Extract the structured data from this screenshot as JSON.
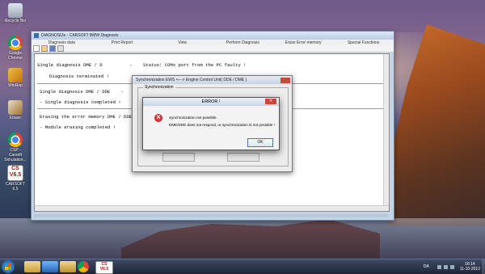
{
  "desktop": {
    "icons": [
      {
        "label": "Recycle Bin",
        "icon": "recycle-bin-icon"
      },
      {
        "label": "Google Chrome",
        "icon": "chrome-icon"
      },
      {
        "label": "WinRep",
        "icon": "tool-icon"
      },
      {
        "label": "Ebase",
        "icon": "tool-icon"
      },
      {
        "label": "CSP - Carsoft Simulation...",
        "icon": "chrome-icon"
      },
      {
        "label": "CARSOFT 6.5",
        "icon": "carsoft-icon"
      }
    ]
  },
  "app": {
    "title": "DIAGNOSIZe - CARSOFT BMW Diagnosis",
    "menu": [
      "Diagnosis data",
      "Print Report",
      "View",
      "Perform Diagnosis",
      "Erase Error memory",
      "Special Functions"
    ],
    "console_lines": [
      "Single diagnosis DME / D          -    Status: COMx port from the PC faulty !",
      "Diagnosis terminated !",
      "Single diagnosis DME / DDE    -    Stat",
      "- Single diagnosis completed !",
      "Erasing the error memory DME / DDE",
      "- Module erasing completed !"
    ]
  },
  "sync_window": {
    "title": "Synchronization EWS <---> Engine Control Unit( DDE / DME )",
    "group_label": "Synchronization"
  },
  "error_dialog": {
    "title": "ERROR !",
    "message_line1": "Synchronization not possible.",
    "message_line2": "DME/DDE does not respond, or synchronization is not possible !",
    "ok_label": "OK"
  },
  "taskbar": {
    "apps": [
      "explorer-icon",
      "media-player-icon",
      "folder-icon",
      "chrome-icon",
      "carsoft-icon"
    ],
    "tray_lang": "DA",
    "clock_time": "16:14",
    "clock_date": "11-10-2012"
  },
  "colors": {
    "error_red": "#c9473a",
    "taskbar": "#1e2638",
    "window_frame": "#c4d3e6"
  }
}
